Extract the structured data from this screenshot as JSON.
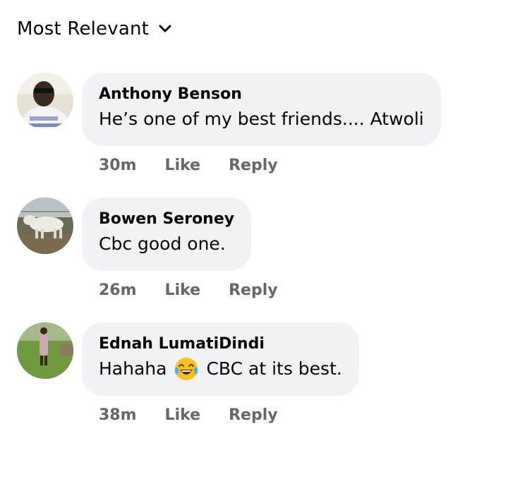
{
  "sort": {
    "label": "Most Relevant"
  },
  "comments": [
    {
      "author": "Anthony Benson",
      "text": "He’s one of my best friends.... Atwoli",
      "time": "30m",
      "like": "Like",
      "reply": "Reply"
    },
    {
      "author": "Bowen Seroney",
      "text": "Cbc good one.",
      "time": "26m",
      "like": "Like",
      "reply": "Reply"
    },
    {
      "author": "Ednah LumatiDindi",
      "text_before": "Hahaha",
      "emoji": "tears-of-joy-emoji",
      "text_after": "CBC at its best.",
      "time": "38m",
      "like": "Like",
      "reply": "Reply"
    }
  ],
  "colors": {
    "bubble": "#f0f2f5",
    "meta_text": "#65676b",
    "primary_text": "#050505"
  }
}
